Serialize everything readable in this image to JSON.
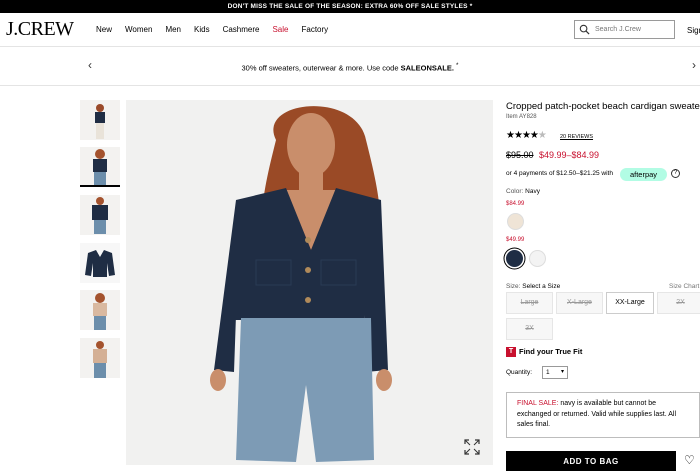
{
  "top_banner": {
    "text": "DON'T MISS THE SALE OF THE SEASON: EXTRA 60% OFF SALE STYLES",
    "icon": "asterisk-icon"
  },
  "header": {
    "logo": "J.CREW",
    "nav": [
      "New",
      "Women",
      "Men",
      "Kids",
      "Cashmere",
      "Sale",
      "Factory"
    ],
    "search_placeholder": "Search J.Crew",
    "sign_in": "Sign"
  },
  "promo": {
    "text_prefix": "30% off sweaters, outerwear & more. Use code ",
    "code": "SALEONSALE.",
    "asterisk": "*"
  },
  "product": {
    "title": "Cropped patch-pocket beach cardigan sweater",
    "item": "Item AY828",
    "rating": 4,
    "rating_max": 5,
    "reviews": "20 REVIEWS",
    "price_original": "$95.00",
    "price_sale": "$49.99–$84.99",
    "afterpay_text": "or 4 payments of $12.50–$21.25 with",
    "afterpay_brand": "afterpay",
    "color_label": "Color:",
    "color_value": "Navy",
    "swatch_groups": [
      {
        "price": "$84.99",
        "swatches": [
          {
            "name": "beige",
            "color": "#efe4d6"
          }
        ]
      },
      {
        "price": "$49.99",
        "swatches": [
          {
            "name": "navy",
            "color": "#1f2d44",
            "selected": true
          },
          {
            "name": "white",
            "color": "#f3f3f3"
          }
        ]
      }
    ],
    "size_label": "Size:",
    "size_value": "Select a Size",
    "size_chart": "Size Chart",
    "sizes": [
      {
        "label": "Large",
        "available": false
      },
      {
        "label": "X-Large",
        "available": false
      },
      {
        "label": "XX-Large",
        "available": true
      },
      {
        "label": "2X",
        "available": false
      },
      {
        "label": "3X",
        "available": false
      }
    ],
    "true_fit": "Find your True Fit",
    "quantity_label": "Quantity:",
    "quantity_value": "1",
    "final_sale_label": "FINAL SALE:",
    "final_sale_text": " navy is available but cannot be exchanged or returned. Valid while supplies last. All sales final.",
    "add_to_bag": "ADD TO BAG"
  }
}
